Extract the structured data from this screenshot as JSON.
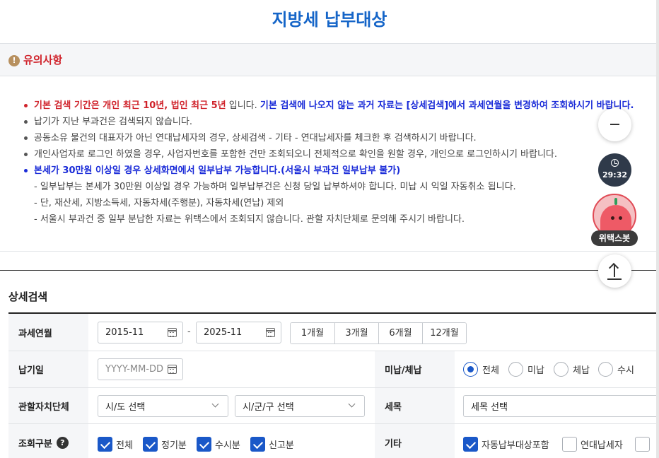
{
  "page": {
    "title": "지방세 납부대상"
  },
  "notice": {
    "title": "유의사항",
    "line1_red": "기본 검색 기간은 개인 최근 10년, 법인 최근 5년",
    "line1_mid": " 입니다. ",
    "line1_blue": "기본 검색에 나오지 않는 과거 자료는 [상세검색]에서 과세연월을 변경하여 조회하시기 바랍니다.",
    "line2": "납기가 지난 부과건은 검색되지 않습니다.",
    "line3": "공동소유 물건의 대표자가 아닌 연대납세자의 경우, 상세검색 - 기타 - 연대납세자를 체크한 후 검색하시기 바랍니다.",
    "line4": "개인사업자로 로그인 하였을 경우, 사업자번호를 포함한 건만 조회되오니 전체적으로 확인을 원할 경우, 개인으로 로그인하시기 바랍니다.",
    "line5_blue": "본세가 30만원 이상일 경우 상세화면에서 일부납부 가능합니다.(서울시 부과건 일부납부 불가)",
    "sub1": "- 일부납부는 본세가 30만원 이상일 경우 가능하며 일부납부건은 신청 당일 납부하셔야 합니다. 미납 시 익일 자동취소 됩니다.",
    "sub2": "- 단, 재산세, 지방소득세, 자동차세(주행분), 자동차세(연납) 제외",
    "sub3": "- 서울시 부과건 중 일부 분납한 자료는 위택스에서 조회되지 않습니다. 관할 자치단체로 문의해 주시기 바랍니다."
  },
  "search": {
    "section_title": "상세검색",
    "tax_period": {
      "label": "과세연월",
      "from": "2015-11",
      "to": "2025-11",
      "separator": "-",
      "period_buttons": [
        "1개월",
        "3개월",
        "6개월",
        "12개월"
      ]
    },
    "due_date": {
      "label": "납기일",
      "placeholder": "YYYY-MM-DD"
    },
    "payment_status": {
      "label": "미납/체납",
      "options": [
        "전체",
        "미납",
        "체납",
        "수시"
      ],
      "selected": "전체"
    },
    "jurisdiction": {
      "label": "관할자치단체",
      "sido_value": "시/도 선택",
      "sigungu_value": "시/군/구 선택"
    },
    "tax_item": {
      "label": "세목",
      "value": "세목 선택"
    },
    "query_type": {
      "label": "조회구분",
      "help": "?",
      "options": [
        "전체",
        "정기분",
        "수시분",
        "신고분"
      ]
    },
    "etc": {
      "label": "기타",
      "auto_pay": "자동납부대상포함",
      "joint_taxpayer": "연대납세자"
    }
  },
  "floating": {
    "timer": "29:32",
    "bot_label": "위택스봇"
  }
}
